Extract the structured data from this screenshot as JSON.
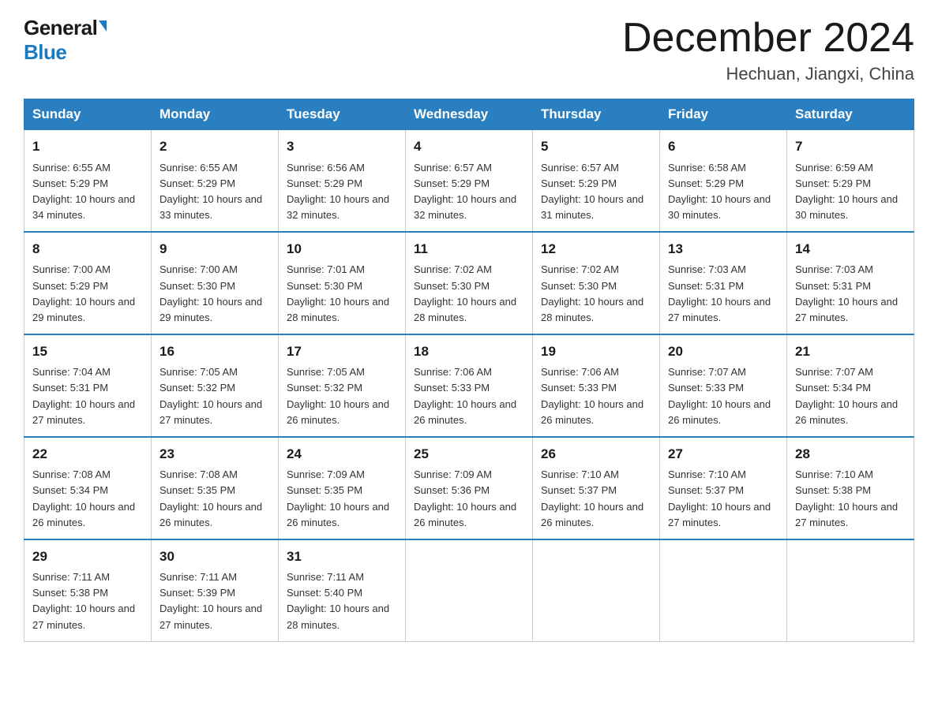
{
  "header": {
    "logo_general": "General",
    "logo_blue": "Blue",
    "month_title": "December 2024",
    "location": "Hechuan, Jiangxi, China"
  },
  "days_of_week": [
    "Sunday",
    "Monday",
    "Tuesday",
    "Wednesday",
    "Thursday",
    "Friday",
    "Saturday"
  ],
  "weeks": [
    [
      {
        "day": "1",
        "sunrise": "Sunrise: 6:55 AM",
        "sunset": "Sunset: 5:29 PM",
        "daylight": "Daylight: 10 hours and 34 minutes."
      },
      {
        "day": "2",
        "sunrise": "Sunrise: 6:55 AM",
        "sunset": "Sunset: 5:29 PM",
        "daylight": "Daylight: 10 hours and 33 minutes."
      },
      {
        "day": "3",
        "sunrise": "Sunrise: 6:56 AM",
        "sunset": "Sunset: 5:29 PM",
        "daylight": "Daylight: 10 hours and 32 minutes."
      },
      {
        "day": "4",
        "sunrise": "Sunrise: 6:57 AM",
        "sunset": "Sunset: 5:29 PM",
        "daylight": "Daylight: 10 hours and 32 minutes."
      },
      {
        "day": "5",
        "sunrise": "Sunrise: 6:57 AM",
        "sunset": "Sunset: 5:29 PM",
        "daylight": "Daylight: 10 hours and 31 minutes."
      },
      {
        "day": "6",
        "sunrise": "Sunrise: 6:58 AM",
        "sunset": "Sunset: 5:29 PM",
        "daylight": "Daylight: 10 hours and 30 minutes."
      },
      {
        "day": "7",
        "sunrise": "Sunrise: 6:59 AM",
        "sunset": "Sunset: 5:29 PM",
        "daylight": "Daylight: 10 hours and 30 minutes."
      }
    ],
    [
      {
        "day": "8",
        "sunrise": "Sunrise: 7:00 AM",
        "sunset": "Sunset: 5:29 PM",
        "daylight": "Daylight: 10 hours and 29 minutes."
      },
      {
        "day": "9",
        "sunrise": "Sunrise: 7:00 AM",
        "sunset": "Sunset: 5:30 PM",
        "daylight": "Daylight: 10 hours and 29 minutes."
      },
      {
        "day": "10",
        "sunrise": "Sunrise: 7:01 AM",
        "sunset": "Sunset: 5:30 PM",
        "daylight": "Daylight: 10 hours and 28 minutes."
      },
      {
        "day": "11",
        "sunrise": "Sunrise: 7:02 AM",
        "sunset": "Sunset: 5:30 PM",
        "daylight": "Daylight: 10 hours and 28 minutes."
      },
      {
        "day": "12",
        "sunrise": "Sunrise: 7:02 AM",
        "sunset": "Sunset: 5:30 PM",
        "daylight": "Daylight: 10 hours and 28 minutes."
      },
      {
        "day": "13",
        "sunrise": "Sunrise: 7:03 AM",
        "sunset": "Sunset: 5:31 PM",
        "daylight": "Daylight: 10 hours and 27 minutes."
      },
      {
        "day": "14",
        "sunrise": "Sunrise: 7:03 AM",
        "sunset": "Sunset: 5:31 PM",
        "daylight": "Daylight: 10 hours and 27 minutes."
      }
    ],
    [
      {
        "day": "15",
        "sunrise": "Sunrise: 7:04 AM",
        "sunset": "Sunset: 5:31 PM",
        "daylight": "Daylight: 10 hours and 27 minutes."
      },
      {
        "day": "16",
        "sunrise": "Sunrise: 7:05 AM",
        "sunset": "Sunset: 5:32 PM",
        "daylight": "Daylight: 10 hours and 27 minutes."
      },
      {
        "day": "17",
        "sunrise": "Sunrise: 7:05 AM",
        "sunset": "Sunset: 5:32 PM",
        "daylight": "Daylight: 10 hours and 26 minutes."
      },
      {
        "day": "18",
        "sunrise": "Sunrise: 7:06 AM",
        "sunset": "Sunset: 5:33 PM",
        "daylight": "Daylight: 10 hours and 26 minutes."
      },
      {
        "day": "19",
        "sunrise": "Sunrise: 7:06 AM",
        "sunset": "Sunset: 5:33 PM",
        "daylight": "Daylight: 10 hours and 26 minutes."
      },
      {
        "day": "20",
        "sunrise": "Sunrise: 7:07 AM",
        "sunset": "Sunset: 5:33 PM",
        "daylight": "Daylight: 10 hours and 26 minutes."
      },
      {
        "day": "21",
        "sunrise": "Sunrise: 7:07 AM",
        "sunset": "Sunset: 5:34 PM",
        "daylight": "Daylight: 10 hours and 26 minutes."
      }
    ],
    [
      {
        "day": "22",
        "sunrise": "Sunrise: 7:08 AM",
        "sunset": "Sunset: 5:34 PM",
        "daylight": "Daylight: 10 hours and 26 minutes."
      },
      {
        "day": "23",
        "sunrise": "Sunrise: 7:08 AM",
        "sunset": "Sunset: 5:35 PM",
        "daylight": "Daylight: 10 hours and 26 minutes."
      },
      {
        "day": "24",
        "sunrise": "Sunrise: 7:09 AM",
        "sunset": "Sunset: 5:35 PM",
        "daylight": "Daylight: 10 hours and 26 minutes."
      },
      {
        "day": "25",
        "sunrise": "Sunrise: 7:09 AM",
        "sunset": "Sunset: 5:36 PM",
        "daylight": "Daylight: 10 hours and 26 minutes."
      },
      {
        "day": "26",
        "sunrise": "Sunrise: 7:10 AM",
        "sunset": "Sunset: 5:37 PM",
        "daylight": "Daylight: 10 hours and 26 minutes."
      },
      {
        "day": "27",
        "sunrise": "Sunrise: 7:10 AM",
        "sunset": "Sunset: 5:37 PM",
        "daylight": "Daylight: 10 hours and 27 minutes."
      },
      {
        "day": "28",
        "sunrise": "Sunrise: 7:10 AM",
        "sunset": "Sunset: 5:38 PM",
        "daylight": "Daylight: 10 hours and 27 minutes."
      }
    ],
    [
      {
        "day": "29",
        "sunrise": "Sunrise: 7:11 AM",
        "sunset": "Sunset: 5:38 PM",
        "daylight": "Daylight: 10 hours and 27 minutes."
      },
      {
        "day": "30",
        "sunrise": "Sunrise: 7:11 AM",
        "sunset": "Sunset: 5:39 PM",
        "daylight": "Daylight: 10 hours and 27 minutes."
      },
      {
        "day": "31",
        "sunrise": "Sunrise: 7:11 AM",
        "sunset": "Sunset: 5:40 PM",
        "daylight": "Daylight: 10 hours and 28 minutes."
      },
      {
        "day": "",
        "sunrise": "",
        "sunset": "",
        "daylight": ""
      },
      {
        "day": "",
        "sunrise": "",
        "sunset": "",
        "daylight": ""
      },
      {
        "day": "",
        "sunrise": "",
        "sunset": "",
        "daylight": ""
      },
      {
        "day": "",
        "sunrise": "",
        "sunset": "",
        "daylight": ""
      }
    ]
  ]
}
